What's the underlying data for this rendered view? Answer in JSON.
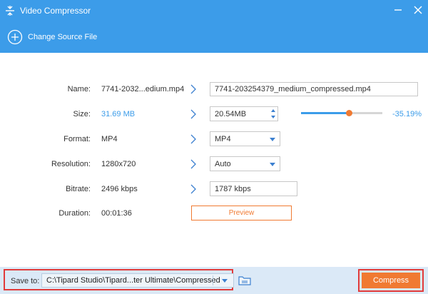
{
  "window": {
    "title": "Video Compressor"
  },
  "source": {
    "change_label": "Change Source File"
  },
  "rows": {
    "name": {
      "label": "Name:",
      "source": "7741-2032...edium.mp4",
      "output": "7741-203254379_medium_compressed.mp4"
    },
    "size": {
      "label": "Size:",
      "source": "31.69 MB",
      "output": "20.54MB",
      "percent": "-35.19%",
      "slider_fraction": 0.59
    },
    "format": {
      "label": "Format:",
      "source": "MP4",
      "output": "MP4"
    },
    "resolution": {
      "label": "Resolution:",
      "source": "1280x720",
      "output": "Auto"
    },
    "bitrate": {
      "label": "Bitrate:",
      "source": "2496 kbps",
      "output": "1787 kbps"
    },
    "duration": {
      "label": "Duration:",
      "source": "00:01:36"
    }
  },
  "preview": {
    "label": "Preview"
  },
  "footer": {
    "save_label": "Save to:",
    "path": "C:\\Tipard Studio\\Tipard...ter Ultimate\\Compressed",
    "compress_label": "Compress"
  },
  "colors": {
    "accent": "#3c9ce9",
    "orange": "#f07a32",
    "highlight": "#e13b3b"
  },
  "icons": {
    "app": "compress-icon",
    "minimize": "minimize-icon",
    "close": "close-icon",
    "add": "plus-circle-icon",
    "arrow": "chevron-right-icon",
    "dropdown": "triangle-down-icon",
    "folder": "folder-icon"
  }
}
